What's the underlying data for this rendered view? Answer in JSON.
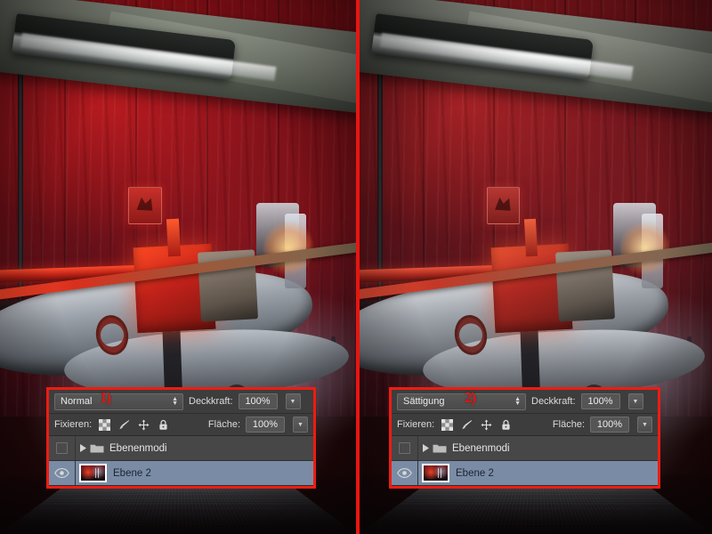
{
  "app": "Adobe Photoshop",
  "comparison": {
    "left": {
      "annotation": "1)",
      "blend_mode": "Normal",
      "opacity_label": "Deckkraft:",
      "opacity_value": "100%",
      "lock_label": "Fixieren:",
      "fill_label": "Fläche:",
      "fill_value": "100%",
      "lock_icons": [
        "transparency-checkerboard-icon",
        "brush-icon",
        "move-icon",
        "lock-all-icon"
      ],
      "layers": [
        {
          "name": "Ebenenmodi",
          "type": "group",
          "visible": false,
          "selected": false,
          "expanded": false
        },
        {
          "name": "Ebene 2",
          "type": "pixel",
          "visible": true,
          "selected": true
        }
      ]
    },
    "right": {
      "annotation": "2)",
      "blend_mode": "Sättigung",
      "opacity_label": "Deckkraft:",
      "opacity_value": "100%",
      "lock_label": "Fixieren:",
      "fill_label": "Fläche:",
      "fill_value": "100%",
      "lock_icons": [
        "transparency-checkerboard-icon",
        "brush-icon",
        "move-icon",
        "lock-all-icon"
      ],
      "layers": [
        {
          "name": "Ebenenmodi",
          "type": "group",
          "visible": false,
          "selected": false,
          "expanded": false
        },
        {
          "name": "Ebene 2",
          "type": "pixel",
          "visible": true,
          "selected": true
        }
      ]
    }
  },
  "colors": {
    "annotation_red": "#e8130d",
    "highlight_border": "#ed1c12",
    "panel_bg": "#3b3b3b",
    "selected_layer": "#7a8ca5"
  }
}
